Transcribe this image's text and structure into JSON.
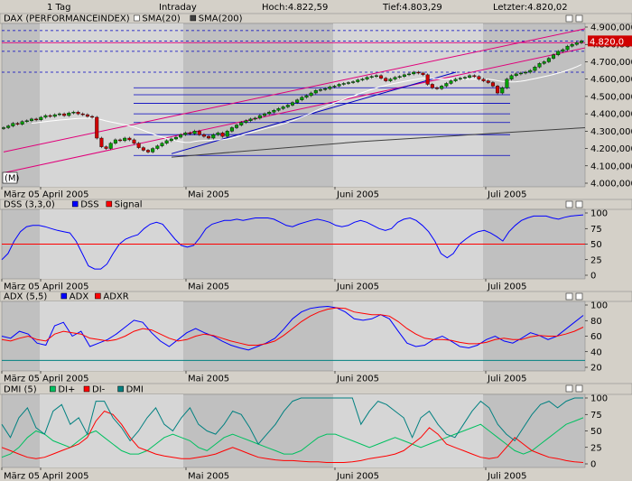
{
  "header": {
    "interval": "1 Tag",
    "session": "Intraday",
    "high_label": "Hoch:4.822,59",
    "low_label": "Tief:4.803,29",
    "last_label": "Letzter:4.820,02"
  },
  "colors": {
    "plot_bg": "#c0c0c0",
    "shade_bg": "#d6d6d6",
    "title_bar": "#d4d0c8",
    "up_candle": "#00a000",
    "down_candle": "#d00000",
    "channel": "#e0007a",
    "support": "#0000c0",
    "sma20": "#ffffff",
    "sma200": "#404040",
    "dss": "#0000ff",
    "signal": "#ff0000",
    "adx": "#0000ff",
    "adxr": "#ff0000",
    "di_plus": "#00c060",
    "di_minus": "#ff0000",
    "dmi": "#008080",
    "price_tag": "#d00000"
  },
  "time_axis": {
    "labels": [
      "März 05",
      "April 2005",
      "Mai 2005",
      "Juni 2005",
      "Juli 2005"
    ],
    "positions": [
      0,
      43,
      204,
      369,
      536
    ]
  },
  "panels": {
    "price": {
      "title": "DAX (PERFORMANCEINDEX)",
      "legend": [
        {
          "label": "SMA(20)",
          "color": "#ffffff"
        },
        {
          "label": "SMA(200)",
          "color": "#404040"
        }
      ],
      "badge": "(M)",
      "price_tag": "4.820,0",
      "ylim": [
        4000,
        4900
      ],
      "y_ticks": [
        "4.900,000",
        "4.800,000",
        "4.700,000",
        "4.600,000",
        "4.500,000",
        "4.400,000",
        "4.300,000",
        "4.200,000",
        "4.100,000",
        "4.000,000"
      ]
    },
    "dss": {
      "title": "DSS (3,3,0)",
      "legend": [
        {
          "label": "DSS",
          "color": "#0000ff"
        },
        {
          "label": "Signal",
          "color": "#ff0000"
        }
      ],
      "y_ticks": [
        "100",
        "75",
        "50",
        "25",
        "0"
      ]
    },
    "adx": {
      "title": "ADX (5,5)",
      "legend": [
        {
          "label": "ADX",
          "color": "#0000ff"
        },
        {
          "label": "ADXR",
          "color": "#ff0000"
        }
      ],
      "y_ticks": [
        "100",
        "80",
        "60",
        "40",
        "20"
      ]
    },
    "dmi": {
      "title": "DMI (5)",
      "legend": [
        {
          "label": "DI+",
          "color": "#00c060"
        },
        {
          "label": "DI-",
          "color": "#ff0000"
        },
        {
          "label": "DMI",
          "color": "#008080"
        }
      ],
      "y_ticks": [
        "100",
        "75",
        "50",
        "25",
        "0"
      ]
    }
  },
  "chart_data": [
    {
      "type": "candlestick",
      "name": "DAX (PERFORMANCEINDEX)",
      "ylim": [
        4000,
        4900
      ],
      "x_index_range": [
        0,
        150
      ],
      "closes": [
        4320,
        4330,
        4345,
        4340,
        4355,
        4360,
        4370,
        4365,
        4380,
        4390,
        4385,
        4395,
        4400,
        4390,
        4405,
        4410,
        4400,
        4395,
        4385,
        4380,
        4260,
        4210,
        4200,
        4230,
        4250,
        4245,
        4260,
        4250,
        4230,
        4205,
        4190,
        4180,
        4200,
        4215,
        4230,
        4245,
        4255,
        4265,
        4280,
        4290,
        4285,
        4300,
        4280,
        4270,
        4260,
        4280,
        4290,
        4270,
        4300,
        4320,
        4335,
        4350,
        4360,
        4370,
        4375,
        4390,
        4400,
        4410,
        4420,
        4430,
        4440,
        4450,
        4465,
        4480,
        4495,
        4505,
        4520,
        4535,
        4540,
        4545,
        4555,
        4560,
        4570,
        4575,
        4580,
        4585,
        4595,
        4600,
        4610,
        4615,
        4620,
        4605,
        4590,
        4600,
        4610,
        4615,
        4625,
        4630,
        4640,
        4635,
        4625,
        4570,
        4550,
        4545,
        4560,
        4575,
        4590,
        4600,
        4605,
        4610,
        4620,
        4615,
        4600,
        4590,
        4580,
        4560,
        4520,
        4550,
        4600,
        4620,
        4630,
        4635,
        4640,
        4650,
        4670,
        4690,
        4700,
        4720,
        4740,
        4760,
        4770,
        4790,
        4800,
        4810,
        4820
      ],
      "sma20_note": "white moving average line",
      "sma200_note": "gray moving average line",
      "channel_lines": [
        [
          0,
          4060
        ],
        [
          150,
          4780
        ]
      ],
      "channel_upper": [
        [
          0,
          4180
        ],
        [
          150,
          4890
        ]
      ],
      "support_levels": [
        4550,
        4510,
        4460,
        4400,
        4350,
        4280,
        4160
      ]
    },
    {
      "type": "line",
      "name": "DSS (3,3,0)",
      "ylim": [
        0,
        100
      ],
      "series": [
        {
          "name": "DSS",
          "values": [
            25,
            35,
            55,
            70,
            78,
            80,
            80,
            78,
            75,
            72,
            70,
            68,
            55,
            35,
            15,
            10,
            10,
            18,
            35,
            50,
            58,
            62,
            65,
            75,
            82,
            85,
            82,
            70,
            58,
            48,
            45,
            48,
            60,
            75,
            82,
            85,
            88,
            88,
            90,
            88,
            90,
            92,
            92,
            92,
            90,
            85,
            80,
            78,
            82,
            85,
            88,
            90,
            88,
            85,
            80,
            78,
            80,
            85,
            88,
            85,
            80,
            75,
            72,
            75,
            85,
            90,
            92,
            88,
            80,
            70,
            55,
            35,
            28,
            35,
            50,
            58,
            65,
            70,
            72,
            68,
            62,
            55,
            70,
            80,
            88,
            92,
            95,
            95,
            95,
            92,
            90,
            93,
            95,
            96,
            97
          ]
        },
        {
          "name": "Signal",
          "values": [
            50
          ]
        }
      ]
    },
    {
      "type": "line",
      "name": "ADX (5,5)",
      "ylim": [
        10,
        100
      ],
      "series": [
        {
          "name": "ADX",
          "values": [
            55,
            52,
            62,
            58,
            45,
            42,
            70,
            75,
            55,
            62,
            40,
            45,
            50,
            58,
            68,
            78,
            75,
            60,
            48,
            40,
            50,
            60,
            66,
            60,
            55,
            48,
            42,
            38,
            35,
            40,
            45,
            52,
            65,
            80,
            90,
            95,
            97,
            98,
            96,
            90,
            80,
            78,
            80,
            86,
            80,
            62,
            45,
            40,
            42,
            50,
            55,
            48,
            40,
            38,
            42,
            50,
            55,
            48,
            45,
            52,
            60,
            56,
            50,
            55,
            65,
            75,
            85
          ]
        },
        {
          "name": "ADXR",
          "values": [
            50,
            48,
            52,
            55,
            50,
            48,
            58,
            62,
            60,
            58,
            52,
            50,
            48,
            50,
            55,
            62,
            66,
            64,
            58,
            52,
            48,
            50,
            55,
            58,
            56,
            52,
            48,
            45,
            42,
            42,
            44,
            48,
            56,
            66,
            76,
            84,
            90,
            94,
            96,
            95,
            90,
            88,
            86,
            86,
            84,
            76,
            66,
            58,
            52,
            50,
            50,
            49,
            46,
            44,
            44,
            46,
            50,
            52,
            50,
            50,
            54,
            56,
            55,
            55,
            58,
            62,
            68
          ]
        }
      ]
    },
    {
      "type": "line",
      "name": "DMI (5)",
      "ylim": [
        0,
        100
      ],
      "series": [
        {
          "name": "DI+",
          "values": [
            10,
            15,
            25,
            40,
            50,
            45,
            35,
            30,
            25,
            35,
            45,
            50,
            40,
            30,
            20,
            15,
            15,
            20,
            30,
            40,
            45,
            40,
            35,
            25,
            20,
            30,
            40,
            45,
            40,
            35,
            30,
            25,
            20,
            15,
            15,
            20,
            30,
            40,
            45,
            45,
            40,
            35,
            30,
            25,
            30,
            35,
            40,
            35,
            30,
            25,
            30,
            35,
            40,
            45,
            50,
            55,
            60,
            50,
            40,
            30,
            20,
            15,
            20,
            30,
            40,
            50,
            60,
            65,
            70
          ]
        },
        {
          "name": "DI-",
          "values": [
            25,
            20,
            15,
            10,
            8,
            10,
            15,
            20,
            25,
            30,
            40,
            65,
            80,
            75,
            60,
            40,
            25,
            20,
            15,
            12,
            10,
            8,
            8,
            10,
            12,
            15,
            20,
            25,
            20,
            15,
            10,
            8,
            6,
            5,
            5,
            4,
            3,
            3,
            2,
            2,
            2,
            3,
            5,
            8,
            10,
            12,
            15,
            20,
            30,
            40,
            55,
            45,
            30,
            25,
            20,
            15,
            10,
            8,
            10,
            25,
            40,
            30,
            20,
            15,
            10,
            8,
            5,
            3,
            2
          ]
        },
        {
          "name": "DMI",
          "values": [
            60,
            40,
            70,
            85,
            55,
            45,
            80,
            90,
            60,
            70,
            45,
            95,
            95,
            70,
            55,
            35,
            50,
            70,
            85,
            60,
            50,
            70,
            85,
            60,
            50,
            45,
            60,
            80,
            75,
            55,
            30,
            45,
            60,
            80,
            95,
            100,
            100,
            100,
            100,
            100,
            100,
            100,
            60,
            80,
            95,
            90,
            80,
            70,
            40,
            70,
            80,
            60,
            45,
            40,
            60,
            80,
            95,
            85,
            60,
            45,
            35,
            55,
            75,
            90,
            95,
            85,
            95,
            100,
            100
          ]
        }
      ]
    }
  ]
}
